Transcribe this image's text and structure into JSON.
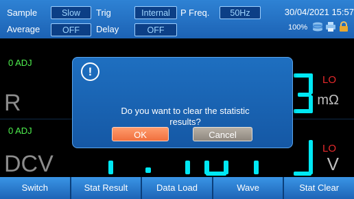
{
  "topbar": {
    "sample_label": "Sample",
    "sample_value": "Slow",
    "trig_label": "Trig",
    "trig_value": "Internal",
    "pfreq_label": "P Freq.",
    "pfreq_value": "50Hz",
    "datetime": "30/04/2021 15:57",
    "average_label": "Average",
    "average_value": "OFF",
    "delay_label": "Delay",
    "delay_value": "OFF",
    "battery": "100%",
    "icons": [
      "storage-icon",
      "printer-icon",
      "lock-icon"
    ]
  },
  "panels": [
    {
      "adj": "0 ADJ",
      "function": "R",
      "limit": "LO",
      "unit": "mΩ"
    },
    {
      "adj": "0 ADJ",
      "function": "DCV",
      "limit": "LO",
      "unit": "V"
    }
  ],
  "softkeys": [
    "Switch",
    "Stat Result",
    "Data Load",
    "Wave",
    "Stat Clear"
  ],
  "dialog": {
    "icon": "!",
    "message_line1": "Do you want to clear the statistic",
    "message_line2": "results?",
    "ok_label": "OK",
    "cancel_label": "Cancel"
  },
  "colors": {
    "bar_blue": "#1c62b4",
    "digit_cyan": "#00e8f4",
    "adj_green": "#4ef04e",
    "lo_red": "#e8292b",
    "ok_orange": "#f0703e",
    "cancel_gray": "#8e877e"
  }
}
